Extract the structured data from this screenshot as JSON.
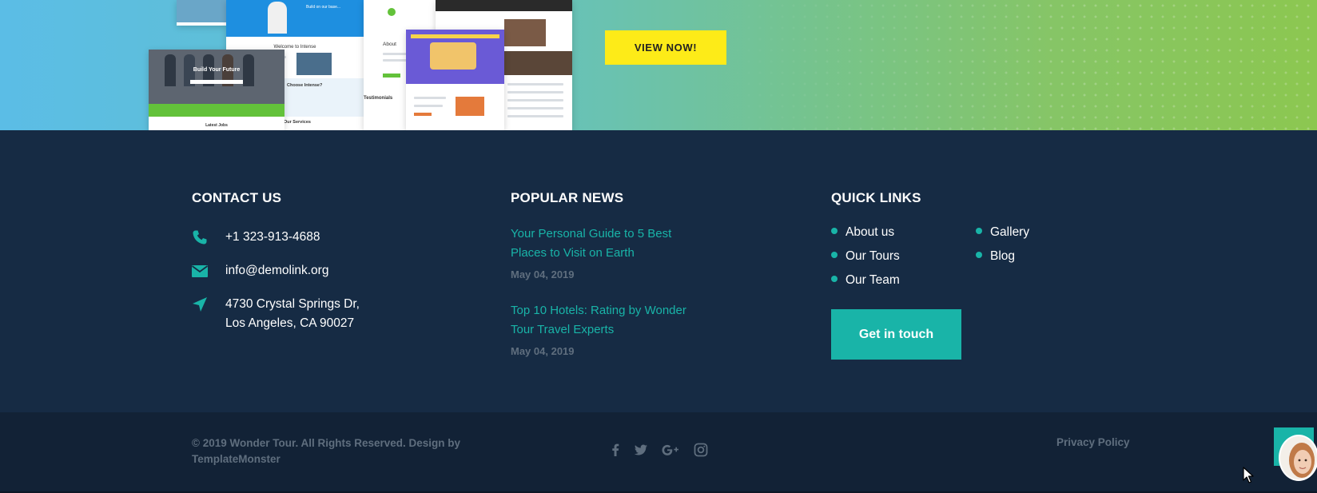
{
  "banner": {
    "view_button_label": "VIEW NOW!",
    "mock_texts": {
      "welcome": "Welcome to Intense",
      "about": "About",
      "build_future": "Build Your Future",
      "choose": "Choose Intense?",
      "testimonials": "Testimonials",
      "services": "Our Services",
      "latest_jobs": "Latest Jobs"
    }
  },
  "footer": {
    "contact": {
      "title": "CONTACT US",
      "phone": "+1 323-913-4688",
      "email": "info@demolink.org",
      "address_line1": "4730 Crystal Springs Dr,",
      "address_line2": "Los Angeles, CA 90027"
    },
    "news": {
      "title": "POPULAR NEWS",
      "items": [
        {
          "title": "Your Personal Guide to 5 Best Places to Visit on Earth",
          "date": "May 04, 2019"
        },
        {
          "title": "Top 10 Hotels: Rating by Wonder Tour Travel Experts",
          "date": "May 04, 2019"
        }
      ]
    },
    "quick_links": {
      "title": "QUICK LINKS",
      "col1": [
        "About us",
        "Our Tours",
        "Our Team"
      ],
      "col2": [
        "Gallery",
        "Blog"
      ],
      "cta_label": "Get in touch"
    }
  },
  "bottom": {
    "copyright": "© 2019 Wonder Tour. All Rights Reserved. Design by TemplateMonster",
    "privacy_label": "Privacy Policy",
    "social_icons": [
      "facebook-icon",
      "twitter-icon",
      "google-plus-icon",
      "instagram-icon"
    ]
  },
  "colors": {
    "accent": "#19b4a8",
    "footer_bg": "#162b44",
    "bottom_bg": "#122236",
    "cta_yellow": "#fdeb18"
  }
}
